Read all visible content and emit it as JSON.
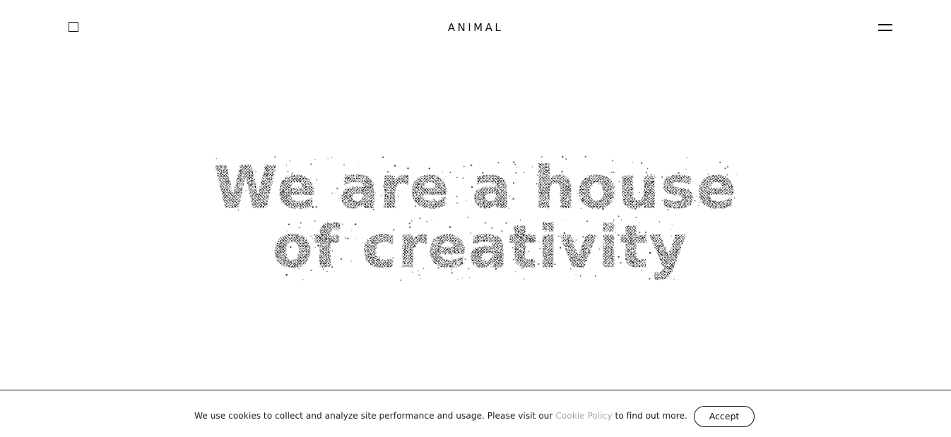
{
  "header": {
    "logo": "ANIMAL",
    "left_toggle_icon": "square-icon",
    "menu_icon": "hamburger-menu-icon"
  },
  "hero": {
    "line1": "We are a house",
    "line2": "of creativity",
    "style": "particle-dot-text",
    "dot_color": "#111111"
  },
  "cookie_banner": {
    "text_before": "We use cookies to collect and analyze site performance and usage. Please visit our ",
    "link_text": "Cookie Policy",
    "text_after": " to find out more.",
    "accept_label": "Accept",
    "link_color": "#aaaaaa"
  }
}
